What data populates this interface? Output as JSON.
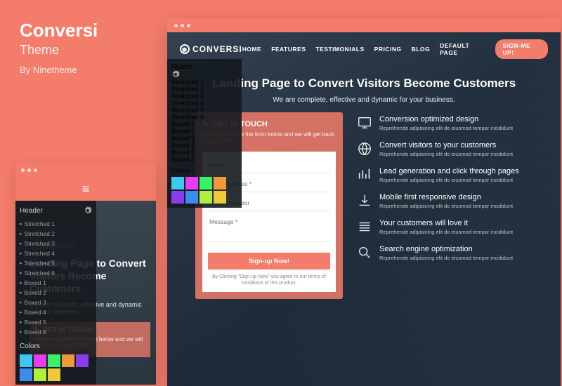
{
  "title": {
    "name": "Conversi",
    "sub": "Theme",
    "by": "By Ninetheme"
  },
  "stylePanel": {
    "header": "Header",
    "items": [
      "Stretched 1",
      "Stretched 2",
      "Stretched 3",
      "Stretched 4",
      "Stretched 5",
      "Stretched 6",
      "Boxed 1",
      "Boxed 2",
      "Boxed 3",
      "Boxed 4",
      "Boxed 5",
      "Boxed 6"
    ],
    "colorsLabel": "Colors",
    "colors": [
      "#3cc8f0",
      "#e83cf0",
      "#3cf066",
      "#f0993c",
      "#8c3cf0",
      "#3c8cf0",
      "#b0f03c",
      "#f0c83c"
    ]
  },
  "mobile": {
    "logo": "CONVERSI",
    "heroTitle": "Landing Page to Convert Visitors Become Customers",
    "heroSub": "We are complete, effective and dynamic for your business.",
    "form": {
      "title": "GET IN TOUCH",
      "sub": "Please complete the form below and we will get back to you ASAP!"
    }
  },
  "desktop": {
    "logo": "CONVERSI",
    "nav": [
      "HOME",
      "FEATURES",
      "TESTIMONIALS",
      "PRICING",
      "BLOG",
      "DEFAULT PAGE"
    ],
    "signup": "SIGN-ME UP!",
    "heroTitle": "Landing Page to Convert Visitors Become Customers",
    "heroSub": "We are complete, effective and dynamic for your business.",
    "form": {
      "title": "GET IN TOUCH",
      "sub": "Please complete the form below and we will get back to you ASAP!",
      "name": "Name",
      "email": "Email Address *",
      "phone": "Phone Number",
      "message": "Message *",
      "button": "Sign-up Now!",
      "disclaimer": "By Clicking \"Sign-up Now\" you agree to our terms of conditions of this product."
    },
    "features": [
      {
        "t": "Conversion optimized design",
        "s": "Reprehende adipisicing elit do eiusmod tempor incididunt"
      },
      {
        "t": "Convert visitors to your customers",
        "s": "Reprehende adipisicing elit do eiusmod tempor incididunt"
      },
      {
        "t": "Lead generation and click through pages",
        "s": "Reprehende adipisicing elit do eiusmod tempor incididunt"
      },
      {
        "t": "Mobile first responsive design",
        "s": "Reprehende adipisicing elit do eiusmod tempor incididunt"
      },
      {
        "t": "Your customers will love it",
        "s": "Reprehende adipisicing elit do eiusmod tempor incididunt"
      },
      {
        "t": "Search engine optimization",
        "s": "Reprehende adipisicing elit do eiusmod tempor incididunt"
      }
    ]
  }
}
